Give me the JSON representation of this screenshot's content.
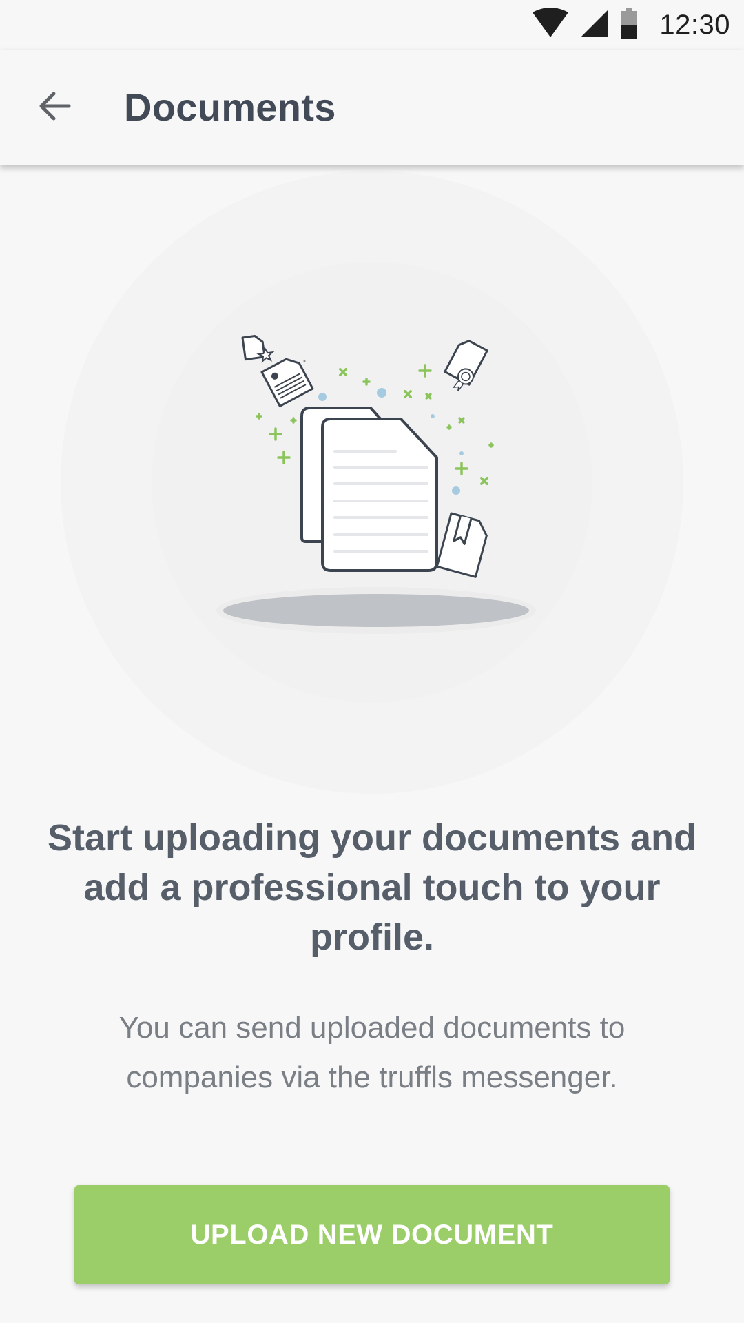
{
  "status_bar": {
    "time": "12:30",
    "icons": [
      "wifi-icon",
      "cell-signal-icon",
      "battery-icon"
    ]
  },
  "app_bar": {
    "back_icon": "arrow-back-icon",
    "title": "Documents"
  },
  "empty_state": {
    "illustration": "documents-illustration",
    "headline": "Start uploading your documents and add a professional touch to your profile.",
    "description": "You can send uploaded documents to companies via the truffls messenger."
  },
  "actions": {
    "upload_label": "UPLOAD NEW DOCUMENT"
  },
  "colors": {
    "accent": "#9bcd68",
    "title": "#424a57",
    "headline": "#565e69",
    "body": "#7a7f86",
    "background": "#f7f7f7"
  }
}
